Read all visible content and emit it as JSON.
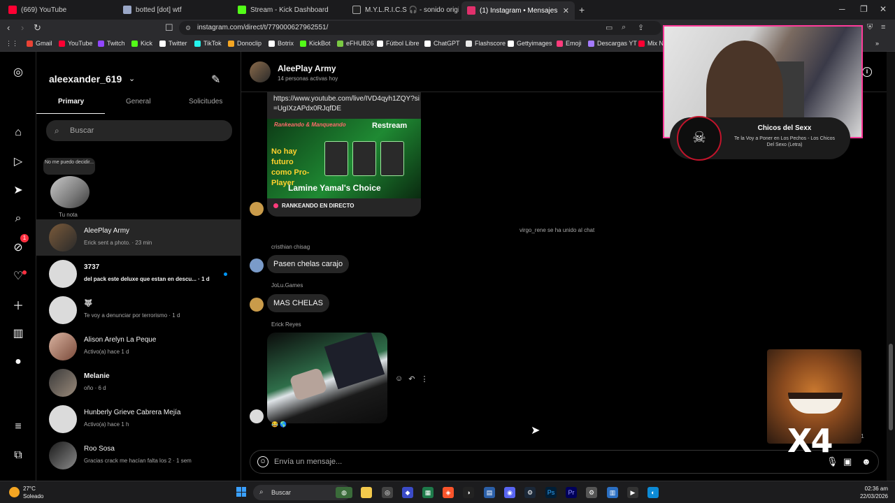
{
  "browser": {
    "tabs": [
      {
        "label": "(669) YouTube",
        "color": "#ff0033"
      },
      {
        "label": "botted [dot] wtf",
        "color": "#9aa7c7"
      },
      {
        "label": "Stream - Kick Dashboard",
        "color": "#53fc18"
      },
      {
        "label": "M.Y.L.R.I.C.S 🎧 - sonido original",
        "color": "#222222"
      },
      {
        "label": "(1) Instagram • Mensajes",
        "color": "#e1306c"
      }
    ],
    "url": "instagram.com/direct/t/779000627962551/",
    "bookmarks": [
      {
        "label": "Gmail",
        "color": "#ea4335"
      },
      {
        "label": "YouTube",
        "color": "#ff0033"
      },
      {
        "label": "Twitch",
        "color": "#9146ff"
      },
      {
        "label": "Kick",
        "color": "#53fc18"
      },
      {
        "label": "Twitter",
        "color": "#ffffff"
      },
      {
        "label": "TikTok",
        "color": "#25f4ee"
      },
      {
        "label": "Donoclip",
        "color": "#f5a623"
      },
      {
        "label": "Botrix",
        "color": "#ffffff"
      },
      {
        "label": "KickBot",
        "color": "#53fc18"
      },
      {
        "label": "eFHUB26",
        "color": "#7ac943"
      },
      {
        "label": "Fútbol Libre",
        "color": "#ffffff"
      },
      {
        "label": "ChatGPT",
        "color": "#ffffff"
      },
      {
        "label": "Flashscore",
        "color": "#e8e8e8"
      },
      {
        "label": "Gettyimages",
        "color": "#ffffff"
      },
      {
        "label": "Emoji",
        "color": "#ff3b7c"
      },
      {
        "label": "Descargas YT",
        "color": "#a57bff"
      },
      {
        "label": "Mix N",
        "color": "#ff0033"
      }
    ]
  },
  "sidebar": {
    "username": "aleexander_619",
    "tabs": [
      "Primary",
      "General",
      "Solicitudes"
    ],
    "search_placeholder": "Buscar",
    "note": {
      "bubble": "No me puedo decidir...",
      "label": "Tu nota"
    },
    "notification_count": "1",
    "conversations": [
      {
        "name": "AleePlay Army",
        "preview": "Erick sent a photo. · 23 min",
        "selected": true,
        "unread": false
      },
      {
        "name": "3737",
        "preview": "del pack este deluxe que estan en descu... · 1 d",
        "selected": false,
        "unread": true
      },
      {
        "name": "🐺",
        "preview": "Te voy a denunciar por terrorismo · 1 d",
        "selected": false,
        "unread": false
      },
      {
        "name": "Alison Arelyn La Peque",
        "preview": "Activo(a) hace 1 d",
        "selected": false,
        "unread": false
      },
      {
        "name": "Melanie",
        "preview": "oño · 6 d",
        "selected": false,
        "unread": false
      },
      {
        "name": "Hunberly Grieve Cabrera Mejía",
        "preview": "Activo(a) hace 1 h",
        "selected": false,
        "unread": false
      },
      {
        "name": "Roo Sosa",
        "preview": "Gracias crack me hacían falta los 2 · 1 sem",
        "selected": false,
        "unread": false
      }
    ]
  },
  "chat": {
    "title": "AleePlay Army",
    "subtitle": "14 personas activas hoy",
    "link_message": {
      "url_text": "https://www.youtube.com/live/IVD4qyh1ZQY?si=UgIXzAPdx0RJqfDE",
      "thumb_top": "Rankeando & Manqueando",
      "thumb_restream": "Restream",
      "thumb_left": "No hay futuro como Pro-Player",
      "thumb_bottom": "Lamine Yamal's Choice",
      "live_label": "RANKEANDO EN DIRECTO"
    },
    "system_message": "virgo_rene se ha unido al chat",
    "messages": [
      {
        "sender": "cristhian chisag",
        "text": "Pasen chelas carajo"
      },
      {
        "sender": "JoLu.Games",
        "text": "MAS CHELAS"
      }
    ],
    "photo_sender": "Erick Reyes",
    "reactions": [
      "😂",
      "🌎"
    ],
    "seen_label": "y 1",
    "composer_placeholder": "Envía un mensaje..."
  },
  "overlay": {
    "cam_title": "Chicos del Sexx",
    "cam_song": "Te la Voy a Poner en Los Pechos - Los Chicos Del Sexo (Letra)",
    "meme_text": "X4"
  },
  "taskbar": {
    "temperature": "27°C",
    "weather": "Soleado",
    "search": "Buscar",
    "time": "02:36 am",
    "date": "22/03/2026"
  }
}
